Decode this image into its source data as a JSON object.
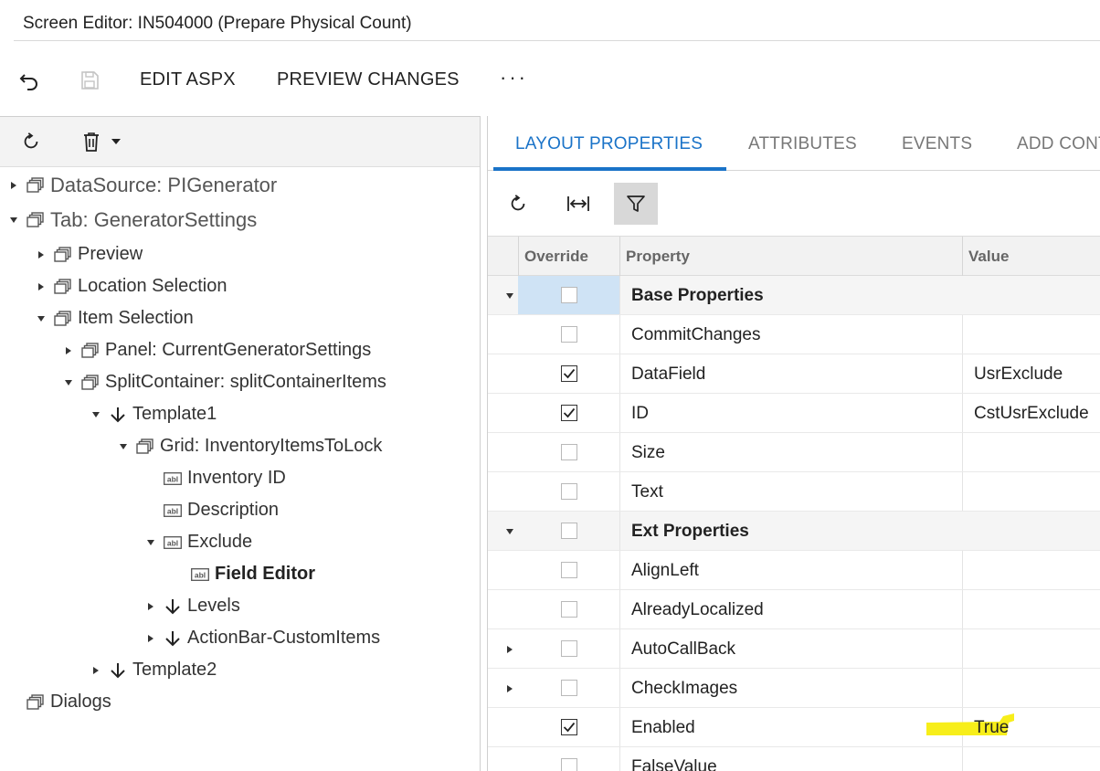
{
  "window": {
    "title": "Screen Editor: IN504000 (Prepare Physical Count)"
  },
  "toolbar": {
    "undo_icon": "undo-icon",
    "save_icon": "save-icon",
    "edit_aspx_label": "EDIT ASPX",
    "preview_changes_label": "PREVIEW CHANGES",
    "more_label": "···"
  },
  "tree_toolbar": {
    "refresh_icon": "refresh-icon",
    "delete_icon": "trash-icon",
    "dropdown_icon": "caret-down-icon"
  },
  "tree": {
    "nodes": [
      {
        "label": "DataSource: PIGenerator",
        "icon": "container-icon",
        "toggle": "collapsed"
      },
      {
        "label": "Tab: GeneratorSettings",
        "icon": "container-icon",
        "toggle": "expanded"
      },
      {
        "label": "Preview",
        "icon": "container-icon",
        "toggle": "collapsed"
      },
      {
        "label": "Location Selection",
        "icon": "container-icon",
        "toggle": "collapsed"
      },
      {
        "label": "Item Selection",
        "icon": "container-icon",
        "toggle": "expanded"
      },
      {
        "label": "Panel: CurrentGeneratorSettings",
        "icon": "container-icon",
        "toggle": "collapsed"
      },
      {
        "label": "SplitContainer: splitContainerItems",
        "icon": "container-icon",
        "toggle": "expanded"
      },
      {
        "label": "Template1",
        "icon": "arrow-down-icon",
        "toggle": "expanded"
      },
      {
        "label": "Grid: InventoryItemsToLock",
        "icon": "container-icon",
        "toggle": "expanded"
      },
      {
        "label": "Inventory ID",
        "icon": "field-icon",
        "toggle": "none"
      },
      {
        "label": "Description",
        "icon": "field-icon",
        "toggle": "none"
      },
      {
        "label": "Exclude",
        "icon": "field-icon",
        "toggle": "expanded"
      },
      {
        "label": "Field Editor",
        "icon": "field-icon",
        "toggle": "none",
        "selected": true
      },
      {
        "label": "Levels",
        "icon": "arrow-down-icon",
        "toggle": "collapsed"
      },
      {
        "label": "ActionBar-CustomItems",
        "icon": "arrow-down-icon",
        "toggle": "collapsed"
      },
      {
        "label": "Template2",
        "icon": "arrow-down-icon",
        "toggle": "collapsed"
      },
      {
        "label": "Dialogs",
        "icon": "container-icon",
        "toggle": "none"
      }
    ]
  },
  "tabs": [
    {
      "label": "LAYOUT PROPERTIES",
      "active": true
    },
    {
      "label": "ATTRIBUTES",
      "active": false
    },
    {
      "label": "EVENTS",
      "active": false
    },
    {
      "label": "ADD CONT",
      "active": false
    }
  ],
  "props_toolbar": {
    "refresh_icon": "refresh-icon",
    "fit_columns_icon": "fit-width-icon",
    "filter_icon": "filter-icon",
    "filter_active": true
  },
  "grid": {
    "columns": {
      "override": "Override",
      "property": "Property",
      "value": "Value"
    },
    "rows": [
      {
        "property": "Base Properties",
        "value": "",
        "checked": false,
        "group": true,
        "toggle": "expanded"
      },
      {
        "property": "CommitChanges",
        "value": "",
        "checked": false
      },
      {
        "property": "DataField",
        "value": "UsrExclude",
        "checked": true
      },
      {
        "property": "ID",
        "value": "CstUsrExclude",
        "checked": true
      },
      {
        "property": "Size",
        "value": "",
        "checked": false
      },
      {
        "property": "Text",
        "value": "",
        "checked": false
      },
      {
        "property": "Ext Properties",
        "value": "",
        "checked": false,
        "group": true,
        "toggle": "expanded"
      },
      {
        "property": "AlignLeft",
        "value": "",
        "checked": false
      },
      {
        "property": "AlreadyLocalized",
        "value": "",
        "checked": false
      },
      {
        "property": "AutoCallBack",
        "value": "",
        "checked": false,
        "toggle": "collapsed"
      },
      {
        "property": "CheckImages",
        "value": "",
        "checked": false,
        "toggle": "collapsed"
      },
      {
        "property": "Enabled",
        "value": "True",
        "checked": true,
        "highlight_color": "#f7ee1a"
      },
      {
        "property": "FalseValue",
        "value": "",
        "checked": false
      }
    ]
  },
  "colors": {
    "accent": "#1a73c8",
    "highlight": "#f7ee1a",
    "selected_cell": "#cfe3f5"
  }
}
